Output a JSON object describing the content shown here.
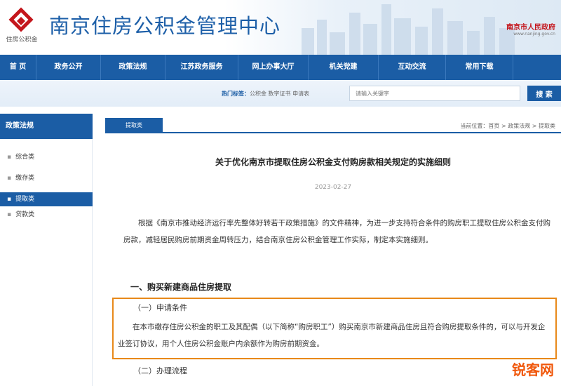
{
  "header": {
    "site_title": "南京住房公积金管理中心",
    "logo_caption": "住房公积金",
    "gov_name": "南京市人民政府",
    "gov_url": "www.nanjing.gov.cn"
  },
  "nav": {
    "items": [
      "首 页",
      "政务公开",
      "政策法规",
      "江苏政务服务",
      "网上办事大厅",
      "机关党建",
      "互动交流",
      "常用下载"
    ]
  },
  "search": {
    "hot_label": "热门标签：",
    "hot_tags": "公积金  数字证书  申请表",
    "placeholder": "请输入关键字",
    "button": "搜 索"
  },
  "sidebar": {
    "title": "政策法规",
    "items": [
      {
        "label": "综合类"
      },
      {
        "label": "缴存类"
      },
      {
        "label": "提取类"
      },
      {
        "label": "贷款类"
      }
    ]
  },
  "main": {
    "tab": "提取类",
    "breadcrumb": "当前位置：首页 > 政策法规 > 提取类",
    "title": "关于优化南京市提取住房公积金支付购房款相关规定的实施细则",
    "date": "2023-02-27",
    "intro": "根据《南京市推动经济运行率先整体好转若干政策措施》的文件精神，为进一步支持符合条件的购房职工提取住房公积金支付购房款，减轻居民购房前期资金周转压力，结合南京住房公积金管理工作实际，制定本实施细则。",
    "section1": "一、购买新建商品住房提取",
    "sub1": "（一）申请条件",
    "sub1_text": "在本市缴存住房公积金的职工及其配偶（以下简称“购房职工”）购买南京市新建商品住房且符合购房提取条件的，可以与开发企业签订协议，用个人住房公积金账户内余额作为购房前期资金。",
    "sub2": "（二）办理流程"
  },
  "watermark": "锐客网",
  "colors": {
    "brand_blue": "#1b5da5",
    "highlight_orange": "#e8891a",
    "gov_red": "#c4161c"
  }
}
